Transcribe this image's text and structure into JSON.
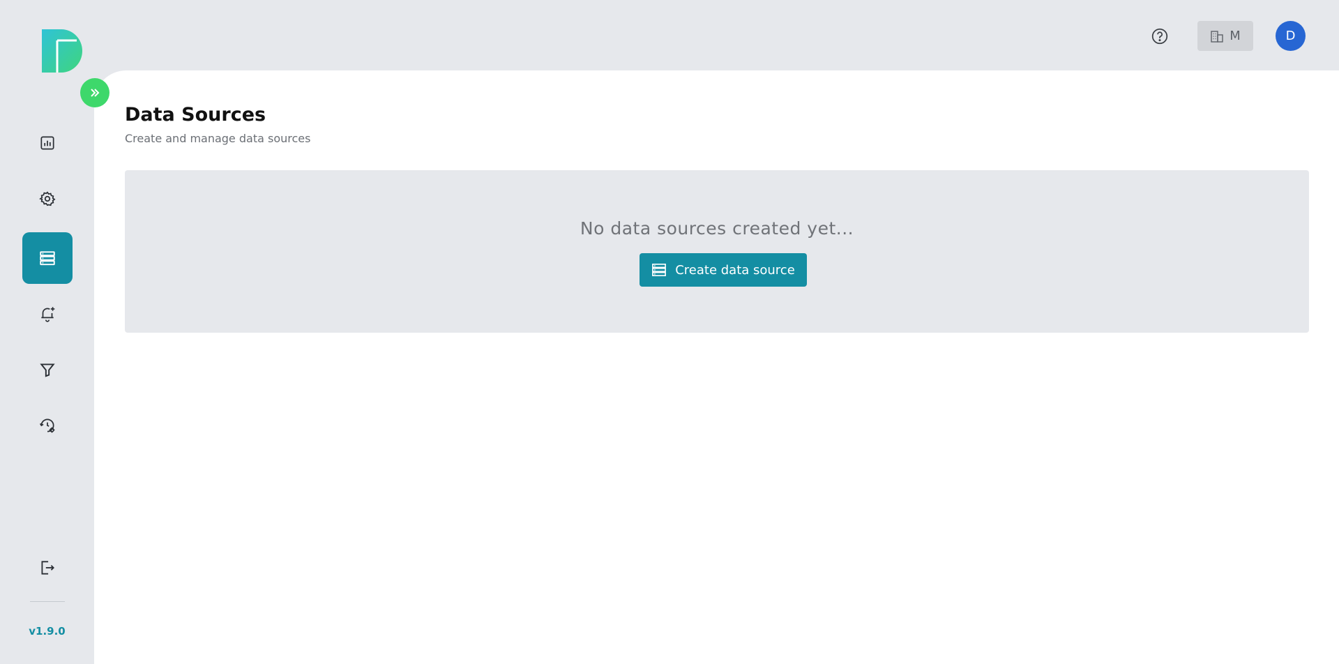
{
  "app": {
    "logo_icon": "brand-logo-icon",
    "version": "v1.9.0"
  },
  "sidebar": {
    "items": [
      {
        "icon": "dashboard-chart-icon",
        "active": false
      },
      {
        "icon": "settings-gear-icon",
        "active": false
      },
      {
        "icon": "data-sources-icon",
        "active": true
      },
      {
        "icon": "alert-bell-plus-icon",
        "active": false
      },
      {
        "icon": "filter-icon",
        "active": false
      },
      {
        "icon": "history-settings-icon",
        "active": false
      }
    ],
    "logout_icon": "logout-icon",
    "expand_icon": "double-chevron-right-icon"
  },
  "topbar": {
    "help_icon": "help-circle-icon",
    "org_label": "M",
    "org_icon": "building-icon",
    "avatar_initial": "D"
  },
  "page": {
    "title": "Data Sources",
    "subtitle": "Create and manage data sources",
    "empty_message": "No data sources created yet...",
    "create_button_label": "Create data source"
  },
  "colors": {
    "accent": "#148ea3",
    "toggle": "#3ed86b",
    "avatar": "#2766d3",
    "background": "#e6e8ec"
  }
}
